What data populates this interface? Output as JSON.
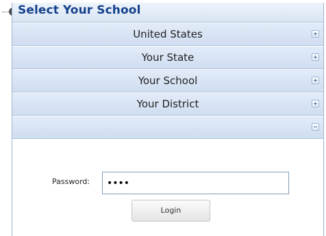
{
  "panel": {
    "title": "Select Your School",
    "accordion": [
      {
        "label": "United States",
        "icon": "plus-icon"
      },
      {
        "label": "Your State",
        "icon": "plus-icon"
      },
      {
        "label": "Your School",
        "icon": "plus-icon"
      },
      {
        "label": "Your District",
        "icon": "plus-icon"
      },
      {
        "label": "",
        "icon": "minus-icon"
      }
    ]
  },
  "login": {
    "password_label": "Password:",
    "password_value": "••••",
    "login_label": "Login"
  },
  "colors": {
    "title": "#15428b",
    "header_bg": "#dfe8f6",
    "border": "#99bbe8"
  }
}
